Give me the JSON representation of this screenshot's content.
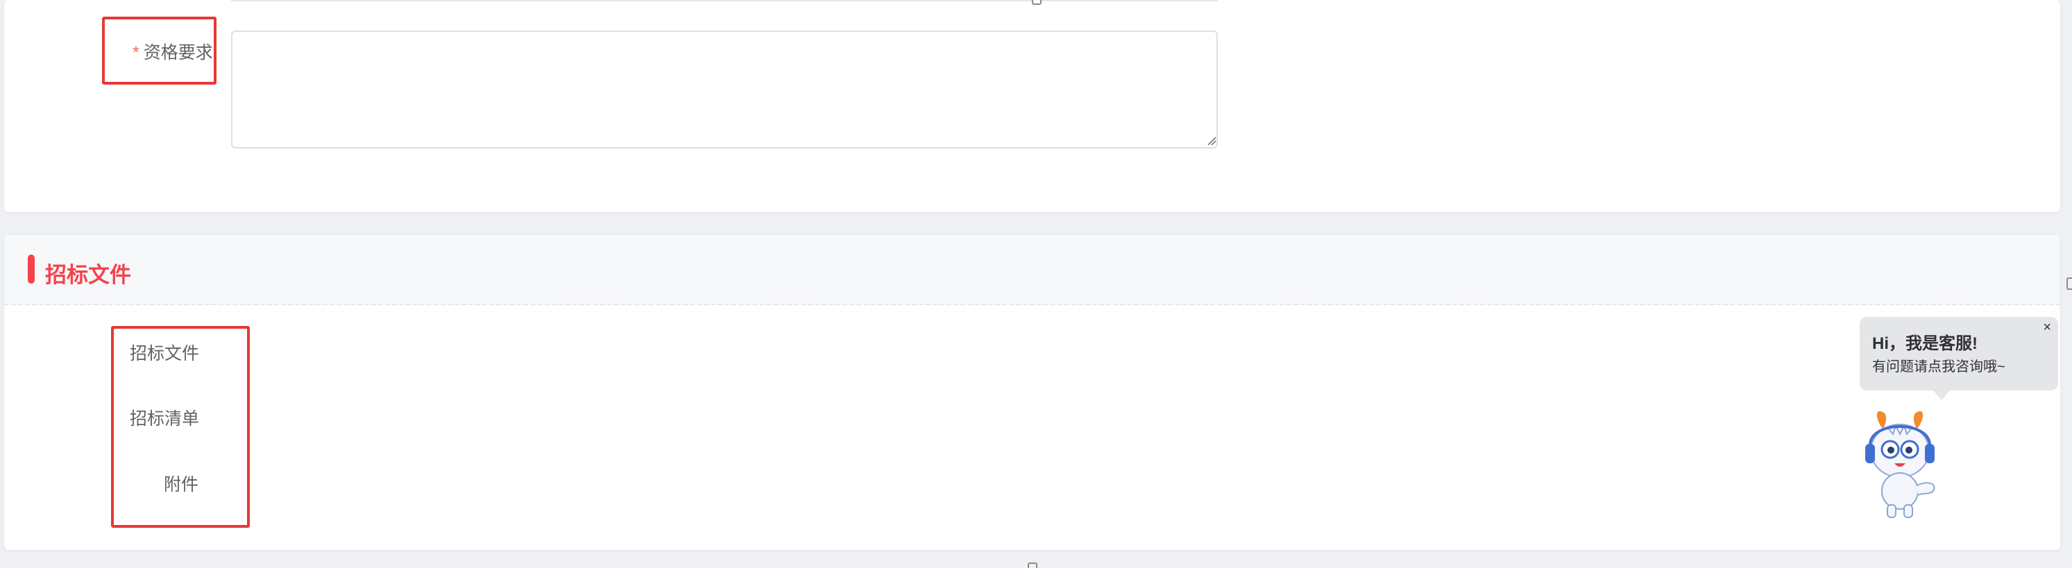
{
  "form": {
    "requirements": {
      "required_mark": "*",
      "label": "资格要求",
      "value": ""
    }
  },
  "section": {
    "title": "招标文件",
    "accent_color": "#f5424b"
  },
  "fields": [
    {
      "label": "招标文件"
    },
    {
      "label": "招标清单"
    },
    {
      "label": "附件"
    }
  ],
  "chat_widget": {
    "title": "Hi，我是客服!",
    "subtitle": "有问题请点我咨询哦~",
    "close_label": "×",
    "mascot_icon": "customer-service-mascot-icon"
  },
  "annotation_color": "#e53935"
}
